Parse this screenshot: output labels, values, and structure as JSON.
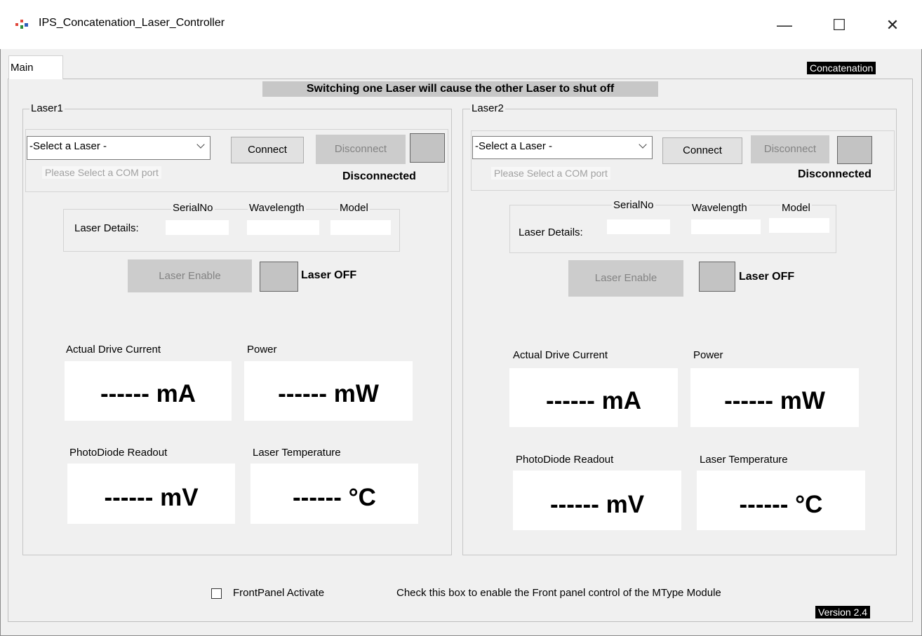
{
  "window": {
    "title": "IPS_Concatenation_Laser_Controller",
    "min_glyph": "—",
    "max_glyph": "☐",
    "close_glyph": "✕"
  },
  "tabs": [
    {
      "label": "Main"
    }
  ],
  "mode_badge": "Concatenation",
  "banner": "Switching one Laser will cause the other Laser to shut off",
  "laser1": {
    "title": "Laser1",
    "select_value": "-Select a Laser -",
    "connect_label": "Connect",
    "disconnect_label": "Disconnect",
    "com_hint": "Please Select a COM port",
    "connection_status": "Disconnected",
    "details_label": "Laser Details:",
    "serial_label": "SerialNo",
    "wavelength_label": "Wavelength",
    "model_label": "Model",
    "enable_label": "Laser Enable",
    "laser_status": "Laser OFF",
    "current_label": "Actual Drive Current",
    "current_value": "------ mA",
    "power_label": "Power",
    "power_value": "------ mW",
    "pd_label": "PhotoDiode Readout",
    "pd_value": "------ mV",
    "temp_label": "Laser Temperature",
    "temp_value": "------ °C"
  },
  "laser2": {
    "title": "Laser2",
    "select_value": "-Select a Laser -",
    "connect_label": "Connect",
    "disconnect_label": "Disconnect",
    "com_hint": "Please Select a COM port",
    "connection_status": "Disconnected",
    "details_label": "Laser Details:",
    "serial_label": "SerialNo",
    "wavelength_label": "Wavelength",
    "model_label": "Model",
    "enable_label": "Laser Enable",
    "laser_status": "Laser OFF",
    "current_label": "Actual Drive Current",
    "current_value": "------ mA",
    "power_label": "Power",
    "power_value": "------ mW",
    "pd_label": "PhotoDiode Readout",
    "pd_value": "------ mV",
    "temp_label": "Laser Temperature",
    "temp_value": "------ °C"
  },
  "footer": {
    "checkbox_label": "FrontPanel Activate",
    "checkbox_checked": false,
    "help_text": "Check this box to enable the Front panel control of the MType Module",
    "version": "Version 2.4"
  }
}
